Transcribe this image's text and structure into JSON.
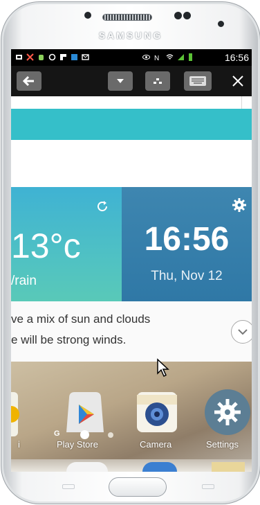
{
  "device": {
    "brand": "SAMSUNG"
  },
  "status_bar": {
    "time": "16:56"
  },
  "toolbar": {
    "back_icon": "back-arrow-icon",
    "dropdown_icon": "chevron-down-icon",
    "menu_icon": "dots-icon",
    "keyboard_icon": "keyboard-icon",
    "close_icon": "close-icon"
  },
  "weather": {
    "temperature": "13°c",
    "condition": "/rain",
    "refresh_icon": "refresh-icon"
  },
  "clock": {
    "time": "16:56",
    "date": "Thu, Nov 12",
    "settings_icon": "gear-icon"
  },
  "forecast": {
    "line1": "ve a mix of sun and clouds",
    "line2": "e will be strong winds."
  },
  "apps": [
    {
      "label": "i",
      "icon": "app-partial-icon"
    },
    {
      "label": "Play Store",
      "icon": "play-store-icon"
    },
    {
      "label": "Camera",
      "icon": "camera-icon"
    },
    {
      "label": "Settings",
      "icon": "settings-icon"
    }
  ],
  "page_indicator": {
    "letter": "G"
  },
  "colors": {
    "weather_bg": "#4fc1c4",
    "clock_bg": "#3e86b0",
    "toolbar_bg": "#151515",
    "accent_strip": "#35bfc9"
  }
}
